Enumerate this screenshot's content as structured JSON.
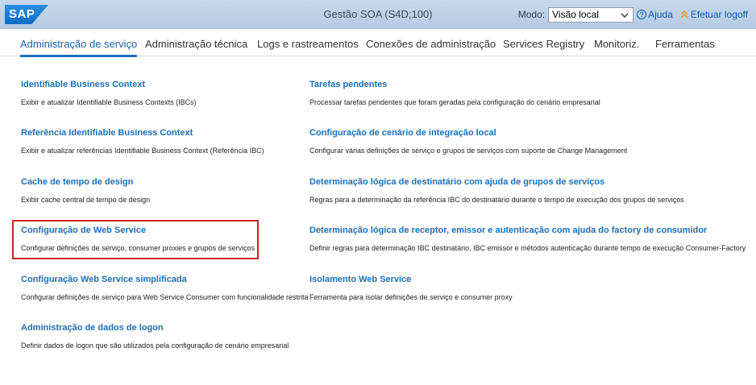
{
  "header": {
    "logo": "SAP",
    "title": "Gestão SOA (S4D;100)",
    "mode_label": "Modo:",
    "mode_value": "Visão local",
    "help_label": "Ajuda",
    "logoff_label": "Efetuar logoff"
  },
  "tabs": [
    {
      "label": "Administração de serviço",
      "active": true
    },
    {
      "label": "Administração técnica"
    },
    {
      "label": "Logs e rastreamentos"
    },
    {
      "label": "Conexões de administração"
    },
    {
      "label": "Services Registry"
    },
    {
      "label": "Monitoriz."
    },
    {
      "label": "Ferramentas"
    }
  ],
  "left_entries": [
    {
      "title": "Identifiable Business Context",
      "desc": "Exibir e atualizar Identifiable Business Contexts (IBCs)"
    },
    {
      "title": "Referência Identifiable Business Context",
      "desc": "Exibir e atualizar referências Identifiable Business Context (Referência IBC)"
    },
    {
      "title": "Cache de tempo de design",
      "desc": "Exibir cache central de tempo de design"
    },
    {
      "title": "Configuração de Web Service",
      "desc": "Configurar definições de serviço, consumer proxies e grupos de serviços",
      "highlighted": true
    },
    {
      "title": "Configuração Web Service simplificada",
      "desc": "Configurar definições de serviço para Web Service Consumer com funcionalidade restrita"
    },
    {
      "title": "Administração de dados de logon",
      "desc": "Definir dados de logon que são utilizados pela configuração de cenário empresarial"
    }
  ],
  "right_entries": [
    {
      "title": "Tarefas pendentes",
      "desc": "Processar tarefas pendentes que foram geradas pela configuração do cenário empresarial"
    },
    {
      "title": "Configuração de cenário de integração local",
      "desc": "Configurar várias definições de serviço e grupos de serviços com suporte de Change Management"
    },
    {
      "title": "Determinação lógica de destinatário com ajuda de grupos de serviços",
      "desc": "Regras para a determinação da referência IBC do destinatário durante o tempo de execução dos grupos de serviços"
    },
    {
      "title": "Determinação lógica de receptor, emissor e autenticação com ajuda do factory de consumidor",
      "desc": "Definir regras para determinação IBC destinatário, IBC emissor e métodos autenticação durante tempo de execução Consumer-Factory"
    },
    {
      "title": "Isolamento Web Service",
      "desc": "Ferramenta para isolar definições de serviço e consumer proxy"
    }
  ],
  "colors": {
    "link": "#1b6fb8",
    "highlight_border": "#d01e28",
    "shell": "#c1d4ea"
  },
  "icons": [
    "chevron-down-icon",
    "help-icon",
    "logoff-icon"
  ]
}
